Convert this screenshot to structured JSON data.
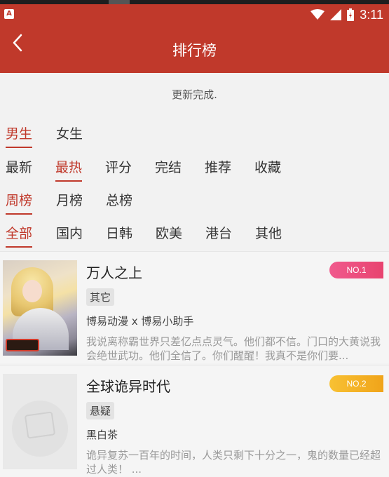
{
  "status_bar": {
    "app_badge": "A",
    "time": "3:11"
  },
  "app_bar": {
    "title": "排行榜"
  },
  "update_message": "更新完成.",
  "filters": {
    "gender": [
      "男生",
      "女生"
    ],
    "sort": [
      "最新",
      "最热",
      "评分",
      "完结",
      "推荐",
      "收藏"
    ],
    "period": [
      "周榜",
      "月榜",
      "总榜"
    ],
    "region": [
      "全部",
      "国内",
      "日韩",
      "欧美",
      "港台",
      "其他"
    ],
    "active": {
      "gender": "男生",
      "sort": "最热",
      "period": "周榜",
      "region": "全部"
    }
  },
  "books": [
    {
      "title": "万人之上",
      "rank": "NO.1",
      "tag": "其它",
      "author": "博易动漫 x 博易小助手",
      "description": "我说离称霸世界只差亿点点灵气。他们都不信。门口的大黄说我会绝世武功。他们全信了。你们醒醒！我真不是你们要..."
    },
    {
      "title": "全球诡异时代",
      "rank": "NO.2",
      "tag": "悬疑",
      "author": "黑白茶",
      "description": "诡异复苏一百年的时间，人类只剩下十分之一，鬼的数量已经超过人类！ ..."
    }
  ],
  "colors": {
    "brand": "#c0392b",
    "rank1": "#e8436f",
    "rank2": "#f0a41a"
  }
}
